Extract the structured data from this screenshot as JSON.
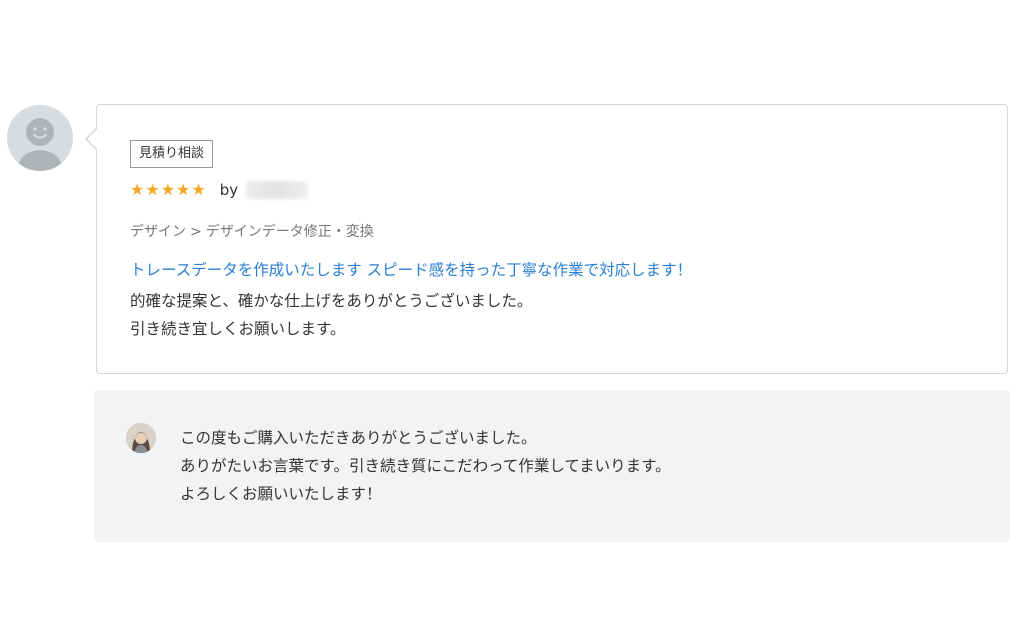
{
  "review": {
    "tag": "見積り相談",
    "rating": 5,
    "stars": [
      "★",
      "★",
      "★",
      "★",
      "★"
    ],
    "by_label": "by",
    "reviewer_name": "",
    "breadcrumb": {
      "category": "デザイン",
      "separator": ">",
      "subcategory": "デザインデータ修正・変換"
    },
    "service_title": "トレースデータを作成いたします スピード感を持った丁寧な作業で対応します！",
    "body_lines": [
      "的確な提案と、確かな仕上げをありがとうございました。",
      "引き続き宜しくお願いします。"
    ]
  },
  "reply": {
    "lines": [
      "この度もご購入いただきありがとうございました。",
      "ありがたいお言葉です。引き続き質にこだわって作業してまいります。",
      "よろしくお願いいたします！"
    ]
  },
  "colors": {
    "star": "#f5a623",
    "link": "#2a7fd4",
    "reply_bg": "#f2f3f5",
    "avatar_bg": "#d9dcdf",
    "border": "#d6d6d6"
  },
  "icons": {
    "reviewer_avatar": "default-user-avatar-icon",
    "seller_avatar": "seller-photo-avatar"
  }
}
